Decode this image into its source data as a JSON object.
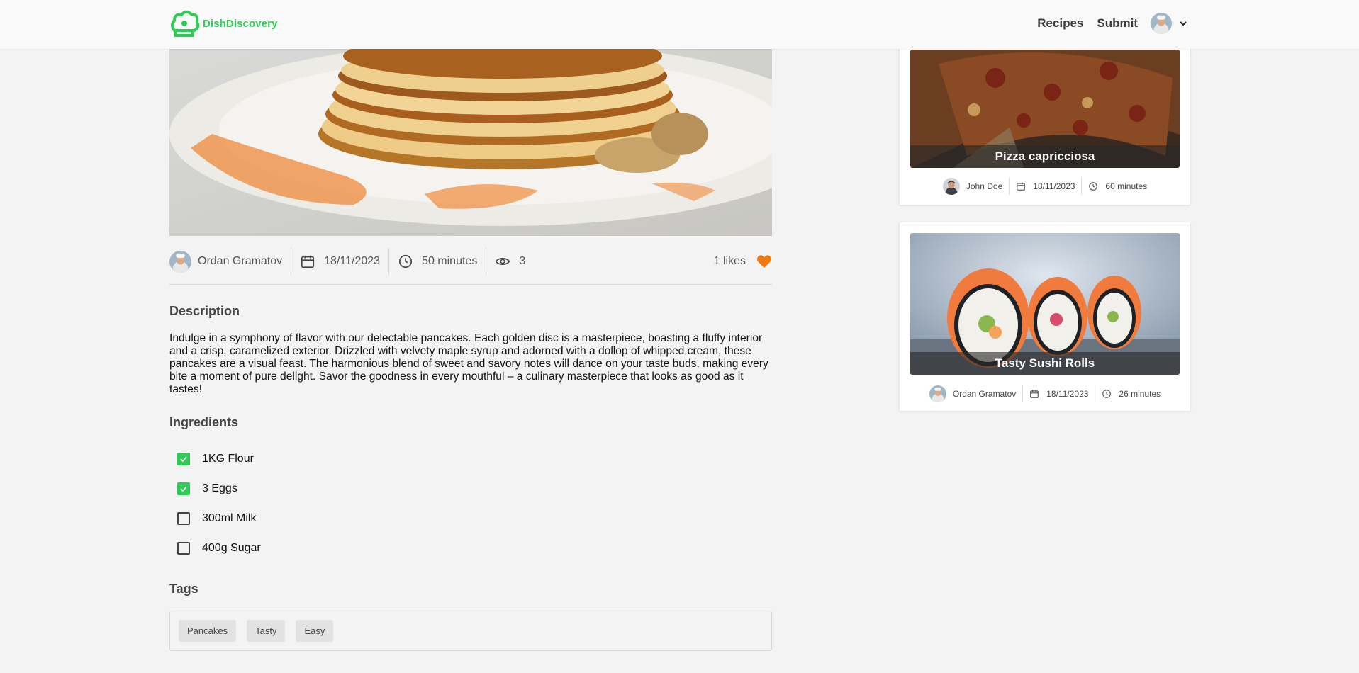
{
  "header": {
    "brand": "DishDiscovery",
    "nav": [
      "Recipes",
      "Submit"
    ],
    "brand_color": "#2ecc54"
  },
  "recipe": {
    "author": "Ordan Gramatov",
    "date": "18/11/2023",
    "time": "50 minutes",
    "views": "3",
    "likes": "1 likes",
    "description_title": "Description",
    "description": "Indulge in a symphony of flavor with our delectable pancakes. Each golden disc is a masterpiece, boasting a fluffy interior and a crisp, caramelized exterior. Drizzled with velvety maple syrup and adorned with a dollop of whipped cream, these pancakes are a visual feast. The harmonious blend of sweet and savory notes will dance on your taste buds, making every bite a moment of pure delight. Savor the goodness in every mouthful – a culinary masterpiece that looks as good as it tastes!",
    "ingredients_title": "Ingredients",
    "ingredients": [
      {
        "label": "1KG Flour",
        "checked": true
      },
      {
        "label": "3 Eggs",
        "checked": true
      },
      {
        "label": "300ml Milk",
        "checked": false
      },
      {
        "label": "400g Sugar",
        "checked": false
      }
    ],
    "tags_title": "Tags",
    "tags": [
      "Pancakes",
      "Tasty",
      "Easy"
    ],
    "heart_color": "#f07a10"
  },
  "sidebar": [
    {
      "title": "Pizza capricciosa",
      "author": "John Doe",
      "date": "18/11/2023",
      "time": "60 minutes"
    },
    {
      "title": "Tasty Sushi Rolls",
      "author": "Ordan Gramatov",
      "date": "18/11/2023",
      "time": "26 minutes"
    }
  ]
}
